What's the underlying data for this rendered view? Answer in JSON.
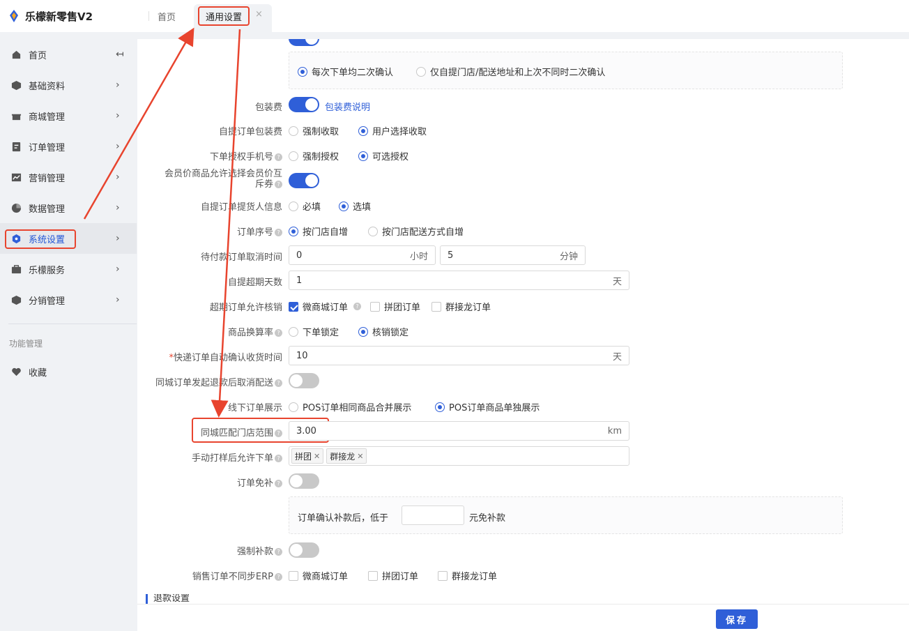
{
  "app": {
    "name": "乐檬新零售V2",
    "brand_color": "#2f5fd8",
    "annotation_color": "#e8442e"
  },
  "tabs": {
    "home": "首页",
    "active": "通用设置",
    "close": "×"
  },
  "sidebar": {
    "items": [
      {
        "label": "首页",
        "icon": "home-icon",
        "arrow": "↤"
      },
      {
        "label": "基础资料",
        "icon": "cube-icon",
        "arrow": "›"
      },
      {
        "label": "商城管理",
        "icon": "store-icon",
        "arrow": "›"
      },
      {
        "label": "订单管理",
        "icon": "order-icon",
        "arrow": "›"
      },
      {
        "label": "营销管理",
        "icon": "chart-line-icon",
        "arrow": "›"
      },
      {
        "label": "数据管理",
        "icon": "pie-chart-icon",
        "arrow": "›"
      },
      {
        "label": "系统设置",
        "icon": "settings-hex-icon",
        "arrow": "›"
      },
      {
        "label": "乐檬服务",
        "icon": "briefcase-icon",
        "arrow": "›"
      },
      {
        "label": "分销管理",
        "icon": "cube-icon",
        "arrow": "›"
      }
    ],
    "section": "功能管理",
    "favorites": {
      "label": "收藏",
      "icon": "heart-icon"
    }
  },
  "form": {
    "confirm_mode": {
      "options": [
        "每次下单均二次确认",
        "仅自提门店/配送地址和上次不同时二次确认"
      ],
      "selected": 0
    },
    "packing_fee": {
      "label": "包装费",
      "enabled": true,
      "link": "包装费说明"
    },
    "pickup_packing_fee": {
      "label": "自提订单包装费",
      "options": [
        "强制收取",
        "用户选择收取"
      ],
      "selected": 1
    },
    "phone_auth": {
      "label": "下单授权手机号",
      "options": [
        "强制授权",
        "可选授权"
      ],
      "selected": 1
    },
    "member_price": {
      "label_line1": "会员价商品允许选择会员价互",
      "label_line2": "斥券",
      "enabled": true
    },
    "pickup_info": {
      "label": "自提订单提货人信息",
      "options": [
        "必填",
        "选填"
      ],
      "selected": 1
    },
    "order_seq": {
      "label": "订单序号",
      "options": [
        "按门店自增",
        "按门店配送方式自增"
      ],
      "selected": 0
    },
    "unpaid_cancel": {
      "label": "待付款订单取消时间",
      "hours": "0",
      "hours_unit": "小时",
      "minutes": "5",
      "minutes_unit": "分钟"
    },
    "pickup_overdue": {
      "label": "自提超期天数",
      "value": "1",
      "unit": "天"
    },
    "overdue_writeoff": {
      "label": "超期订单允许核销",
      "options": [
        {
          "label": "微商城订单",
          "checked": true
        },
        {
          "label": "拼团订单",
          "checked": false
        },
        {
          "label": "群接龙订单",
          "checked": false
        }
      ]
    },
    "conversion_rate": {
      "label": "商品换算率",
      "options": [
        "下单锁定",
        "核销锁定"
      ],
      "selected": 1
    },
    "express_confirm": {
      "required_mark": "*",
      "label": "快递订单自动确认收货时间",
      "value": "10",
      "unit": "天"
    },
    "refund_cancel_delivery": {
      "label": "同城订单发起退款后取消配送",
      "enabled": false
    },
    "offline_display": {
      "label": "线下订单展示",
      "options": [
        "POS订单相同商品合并展示",
        "POS订单商品单独展示"
      ],
      "selected": 1
    },
    "store_range": {
      "label": "同城匹配门店范围",
      "value": "3.00",
      "unit": "km"
    },
    "manual_print": {
      "label": "手动打样后允许下单",
      "tags": [
        "拼团",
        "群接龙"
      ]
    },
    "order_exempt": {
      "label": "订单免补",
      "enabled": false,
      "text_before": "订单确认补款后，低于",
      "text_after": "元免补款",
      "value": ""
    },
    "force_payment": {
      "label": "强制补款",
      "enabled": false
    },
    "erp_sync": {
      "label": "销售订单不同步ERP",
      "options": [
        {
          "label": "微商城订单",
          "checked": false
        },
        {
          "label": "拼团订单",
          "checked": false
        },
        {
          "label": "群接龙订单",
          "checked": false
        }
      ]
    },
    "refund_section": "退款设置"
  },
  "footer": {
    "save": "保存"
  }
}
